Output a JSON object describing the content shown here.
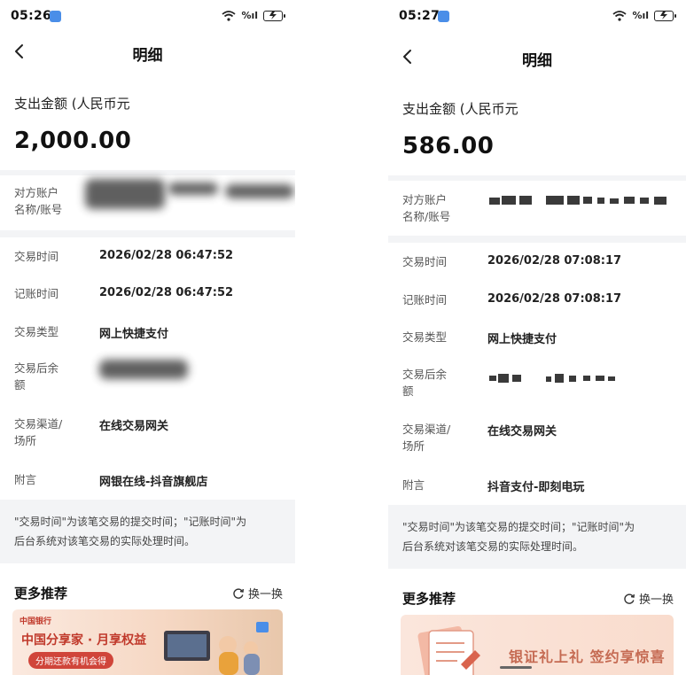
{
  "left": {
    "status": {
      "time": "05:26",
      "signal": "%ıl"
    },
    "nav": {
      "title": "明细"
    },
    "amount": {
      "label": "支出金额 (人民币元",
      "value": "2,000.00"
    },
    "counterparty": {
      "label_line1": "对方账户",
      "label_line2": "名称/账号"
    },
    "rows": [
      {
        "label": "交易时间",
        "value": "2026/02/28 06:47:52"
      },
      {
        "label": "记账时间",
        "value": "2026/02/28 06:47:52"
      },
      {
        "label": "交易类型",
        "value": "网上快捷支付"
      },
      {
        "label_line1": "交易后余",
        "label_line2": "额",
        "value": ""
      },
      {
        "label_line1": "交易渠道/",
        "label_line2": "场所",
        "value": "在线交易网关"
      },
      {
        "label": "附言",
        "value": "网银在线-抖音旗舰店"
      }
    ],
    "note": {
      "line1": "\"交易时间\"为该笔交易的提交时间；\"记账时间\"为",
      "line2": "后台系统对该笔交易的实际处理时间。"
    },
    "more": {
      "title": "更多推荐",
      "refresh_label": "换一换"
    },
    "banner": {
      "logo": "中国银行",
      "main_text": "中国分享家 · 月享权益",
      "sub_text": "分期还款有机会得"
    }
  },
  "right": {
    "status": {
      "time": "05:27",
      "signal": "%ıl"
    },
    "nav": {
      "title": "明细"
    },
    "amount": {
      "label": "支出金额 (人民币元",
      "value": "586.00"
    },
    "counterparty": {
      "label_line1": "对方账户",
      "label_line2": "名称/账号"
    },
    "rows": [
      {
        "label": "交易时间",
        "value": "2026/02/28 07:08:17"
      },
      {
        "label": "记账时间",
        "value": "2026/02/28 07:08:17"
      },
      {
        "label": "交易类型",
        "value": "网上快捷支付"
      },
      {
        "label_line1": "交易后余",
        "label_line2": "额",
        "value": ""
      },
      {
        "label_line1": "交易渠道/",
        "label_line2": "场所",
        "value": "在线交易网关"
      },
      {
        "label": "附言",
        "value": "抖音支付-即刻电玩"
      }
    ],
    "note": {
      "line1": "\"交易时间\"为该笔交易的提交时间；\"记账时间\"为",
      "line2": "后台系统对该笔交易的实际处理时间。"
    },
    "more": {
      "title": "更多推荐",
      "refresh_label": "换一换"
    },
    "banner": {
      "main_text": "银证礼上礼 签约享惊喜"
    }
  },
  "colors": {
    "accent_blue": "#4a8ee8",
    "band_gray": "#f3f4f6",
    "banner_red": "#c0392b"
  },
  "icons": [
    "back-icon",
    "wifi-icon",
    "battery-icon",
    "refresh-icon",
    "document-icon"
  ]
}
